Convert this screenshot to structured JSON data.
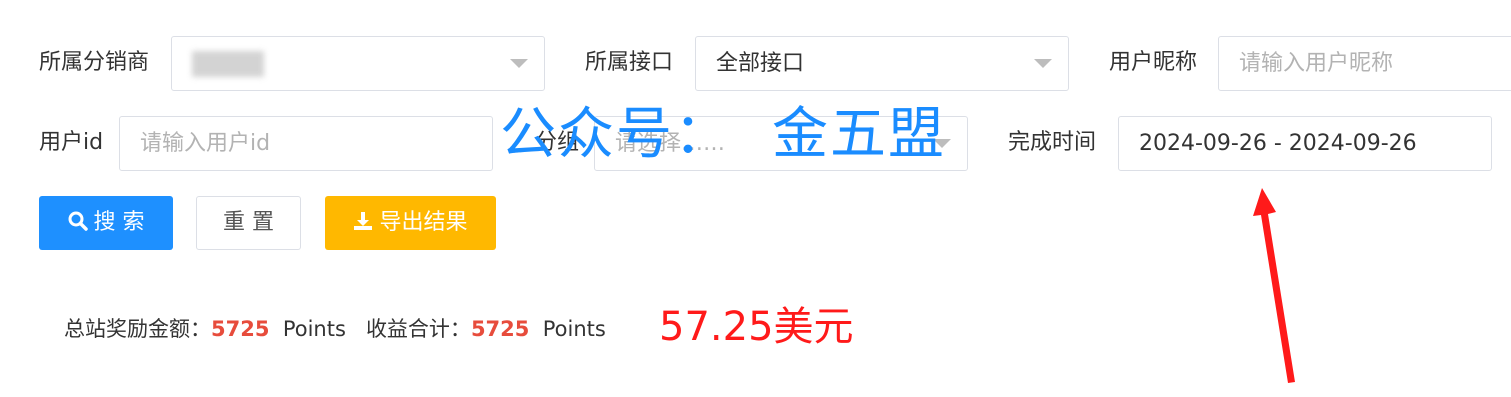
{
  "filters": {
    "distributor": {
      "label": "所属分销商",
      "value": ""
    },
    "interface": {
      "label": "所属接口",
      "value": "全部接口"
    },
    "nickname": {
      "label": "用户昵称",
      "placeholder": "请输入用户昵称"
    },
    "userid": {
      "label": "用户id",
      "placeholder": "请输入用户id"
    },
    "group": {
      "label": "分组",
      "placeholder": "请选择……"
    },
    "finish_time": {
      "label": "完成时间",
      "value": "2024-09-26 - 2024-09-26"
    }
  },
  "buttons": {
    "search": "搜 索",
    "reset": "重 置",
    "export": "导出结果"
  },
  "summary": {
    "reward_label": "总站奖励金额：",
    "reward_value": "5725",
    "reward_unit": "Points",
    "income_label": "收益合计：",
    "income_value": "5725",
    "income_unit": "Points",
    "usd_note": "57.25美元"
  },
  "watermark": {
    "part1": "公众号：",
    "part2": "金五盟"
  },
  "colors": {
    "primary": "#1e90ff",
    "warning": "#ffb800",
    "highlight_red": "#ff1a1a",
    "number_red": "#e74c3c",
    "watermark_blue": "#1a8cff"
  },
  "icons": {
    "search": "search-icon",
    "export": "download-icon",
    "arrow": "red-arrow-annotation"
  }
}
